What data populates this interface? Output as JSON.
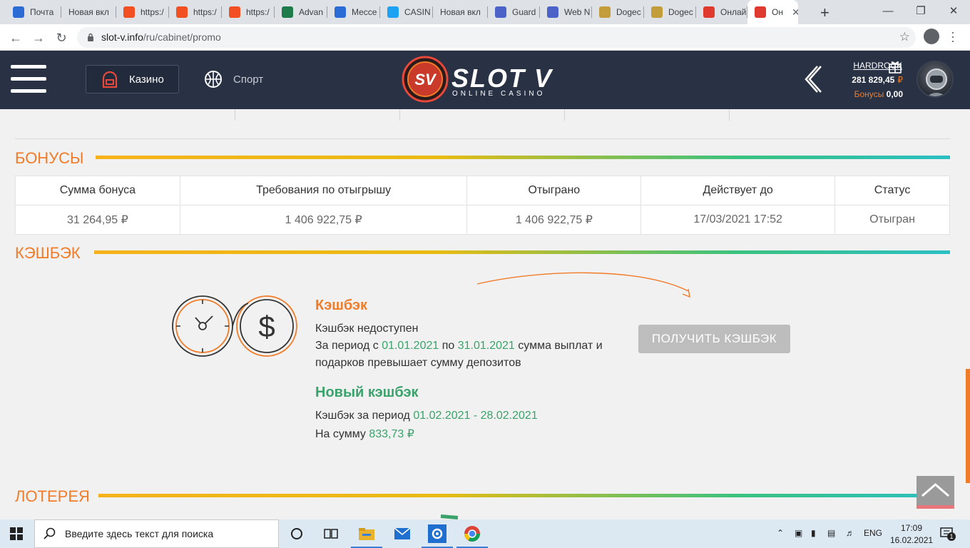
{
  "browser": {
    "tabs": [
      {
        "label": "Почта",
        "favicon": "mail-icon",
        "color": "#2b6bd6"
      },
      {
        "label": "Новая вкл",
        "favicon": "",
        "color": ""
      },
      {
        "label": "https:/",
        "favicon": "ms-icon",
        "color": "#f25022"
      },
      {
        "label": "https:/",
        "favicon": "ms-icon",
        "color": "#f25022"
      },
      {
        "label": "https:/",
        "favicon": "ms-icon",
        "color": "#f25022"
      },
      {
        "label": "Advan",
        "favicon": "star-icon",
        "color": "#1e7b4a"
      },
      {
        "label": "Мессе",
        "favicon": "chat-icon",
        "color": "#2b6bd6"
      },
      {
        "label": "CASIN",
        "favicon": "twitter-icon",
        "color": "#1da1f2"
      },
      {
        "label": "Новая вкл",
        "favicon": "",
        "color": ""
      },
      {
        "label": "Guard",
        "favicon": "shield-icon",
        "color": "#4b63c9"
      },
      {
        "label": "Web N",
        "favicon": "shield-icon",
        "color": "#4b63c9"
      },
      {
        "label": "Dogec",
        "favicon": "doge-icon",
        "color": "#c29d3a"
      },
      {
        "label": "Dogec",
        "favicon": "doge-icon",
        "color": "#c29d3a"
      },
      {
        "label": "Онлай",
        "favicon": "sv-icon",
        "color": "#e03a2f"
      },
      {
        "label": "Он",
        "favicon": "sv-icon",
        "color": "#e03a2f"
      }
    ],
    "url_host": "slot-v.info",
    "url_path": "/ru/cabinet/promo"
  },
  "header": {
    "casino_label": "Казино",
    "sport_label": "Спорт",
    "logo_name": "SLOT V",
    "logo_sub": "ONLINE CASINO",
    "logo_badge": "SV",
    "username": "HARDROCK",
    "balance": "281 829,45",
    "currency": "₽",
    "bonus_label": "Бонусы",
    "bonus_value": "0,00"
  },
  "bonuses": {
    "title": "БОНУСЫ",
    "columns": [
      "Сумма бонуса",
      "Требования по отыгрышу",
      "Отыграно",
      "Действует до",
      "Статус"
    ],
    "rows": [
      [
        "31 264,95  ₽",
        "1 406 922,75  ₽",
        "1 406 922,75  ₽",
        "17/03/2021 17:52",
        "Отыгран"
      ]
    ]
  },
  "cashback": {
    "title": "КЭШБЭК",
    "heading": "Кэшбэк",
    "unavailable": "Кэшбэк недоступен",
    "period_prefix": "За период с",
    "period_from": "01.01.2021",
    "period_mid": "по",
    "period_to": "31.01.2021",
    "period_suffix": "сумма выплат и",
    "period_line2": "подарков превышает сумму депозитов",
    "button": "ПОЛУЧИТЬ КЭШБЭК",
    "new_heading": "Новый кэшбэк",
    "new_period_prefix": "Кэшбэк за период",
    "new_from": "01.02.2021",
    "new_dash": "-",
    "new_to": "28.02.2021",
    "sum_prefix": "На сумму",
    "sum_value": "833,73  ₽"
  },
  "lottery": {
    "title": "ЛОТЕРЕЯ"
  },
  "taskbar": {
    "search_placeholder": "Введите здесь текст для поиска",
    "lang": "ENG",
    "time": "17:09",
    "date": "16.02.2021",
    "notifications": "1"
  },
  "colors": {
    "accent": "#f07c2a",
    "green": "#3aa26b",
    "header_bg": "#283244"
  }
}
